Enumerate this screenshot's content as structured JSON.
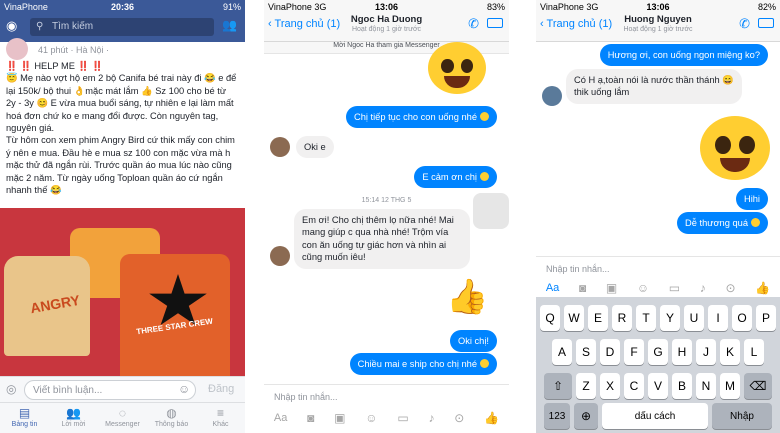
{
  "panel1": {
    "status": {
      "carrier": "VinaPhone",
      "time": "20:36",
      "battery": "91%"
    },
    "search_placeholder": "Tìm kiếm",
    "post": {
      "meta": "41 phút · Hà Nội ·",
      "text": "‼️ ‼️ HELP ME ‼️ ‼️\n😇 Mẹ nào vợt hộ em 2 bộ Canifa bé trai này đi 😂 e để lại 150k/ bộ thui 👌mặc mát lắm 👍 Sz 100 cho bé từ 2y - 3y 😊 E vừa mua buổi sáng, tự nhiên e lại làm mất hoá đơn chứ ko e mang đổi được. Còn nguyên tag, nguyên giá.\nTừ hôm con xem phim Angry Bird cứ thik mấy con chim ý nên e mua. Đầu hè e mua sz 100 con mặc vừa mà h mặc thử đã ngắn rùi. Trước quần áo mua lúc nào cũng mặc 2 năm. Từ ngày uống Toploan quần áo cứ ngắn nhanh thế 😂",
      "photo_text_1": "ANGRY",
      "photo_text_2": "THREE STAR CREW"
    },
    "comment_placeholder": "Viết bình luận...",
    "comment_send": "Đăng",
    "nav": [
      "Bảng tin",
      "Lời mời",
      "Messenger",
      "Thông báo",
      "Khác"
    ]
  },
  "panel2": {
    "status": {
      "carrier": "VinaPhone",
      "net": "3G",
      "time": "13:06",
      "battery": "83%"
    },
    "back": "Trang chủ (1)",
    "name": "Ngoc Ha Duong",
    "sub": "Hoạt động 1 giờ trước",
    "invite": "Mời Ngoc Ha tham gia Messenger",
    "messages": [
      {
        "from": "me",
        "text": "Chị tiếp tục cho con uống nhé"
      },
      {
        "from": "them",
        "text": "Oki e"
      },
      {
        "from": "me",
        "text": "E cảm ơn chị"
      },
      {
        "from": "time",
        "text": "15:14 12 THG 5"
      },
      {
        "from": "them",
        "text": "Em ơi! Cho chị thêm lọ nữa nhé! Mai mang giúp c qua nhà nhé! Trộm vía con ăn uống tự giác hơn và nhìn ai cũng muốn iêu!"
      },
      {
        "from": "me",
        "text": "Oki chị!"
      },
      {
        "from": "me",
        "text": "Chiều mai e ship cho chị nhé"
      }
    ],
    "input_placeholder": "Nhập tin nhắn..."
  },
  "panel3": {
    "status": {
      "carrier": "VinaPhone",
      "net": "3G",
      "time": "13:06",
      "battery": "82%"
    },
    "back": "Trang chủ (1)",
    "name": "Huong Nguyen",
    "sub": "Hoạt động 1 giờ trước",
    "messages": [
      {
        "from": "me",
        "text": "Hương ơi, con uống ngon miệng ko?"
      },
      {
        "from": "them",
        "text": "Có H ạ,toàn nói là nước thần thánh 😄 thik uống lắm"
      },
      {
        "from": "me",
        "text": "Hihi"
      },
      {
        "from": "me",
        "text": "Dễ thương quá"
      }
    ],
    "input_placeholder": "Nhập tin nhắn...",
    "keyboard": {
      "row1": [
        "Q",
        "W",
        "E",
        "R",
        "T",
        "Y",
        "U",
        "I",
        "O",
        "P"
      ],
      "row2": [
        "A",
        "S",
        "D",
        "F",
        "G",
        "H",
        "J",
        "K",
        "L"
      ],
      "row3": [
        "Z",
        "X",
        "C",
        "V",
        "B",
        "N",
        "M"
      ],
      "num": "123",
      "space": "dấu cách",
      "return": "Nhập"
    }
  },
  "colors": {
    "fb_blue": "#3b5998",
    "messenger_blue": "#0084ff"
  }
}
